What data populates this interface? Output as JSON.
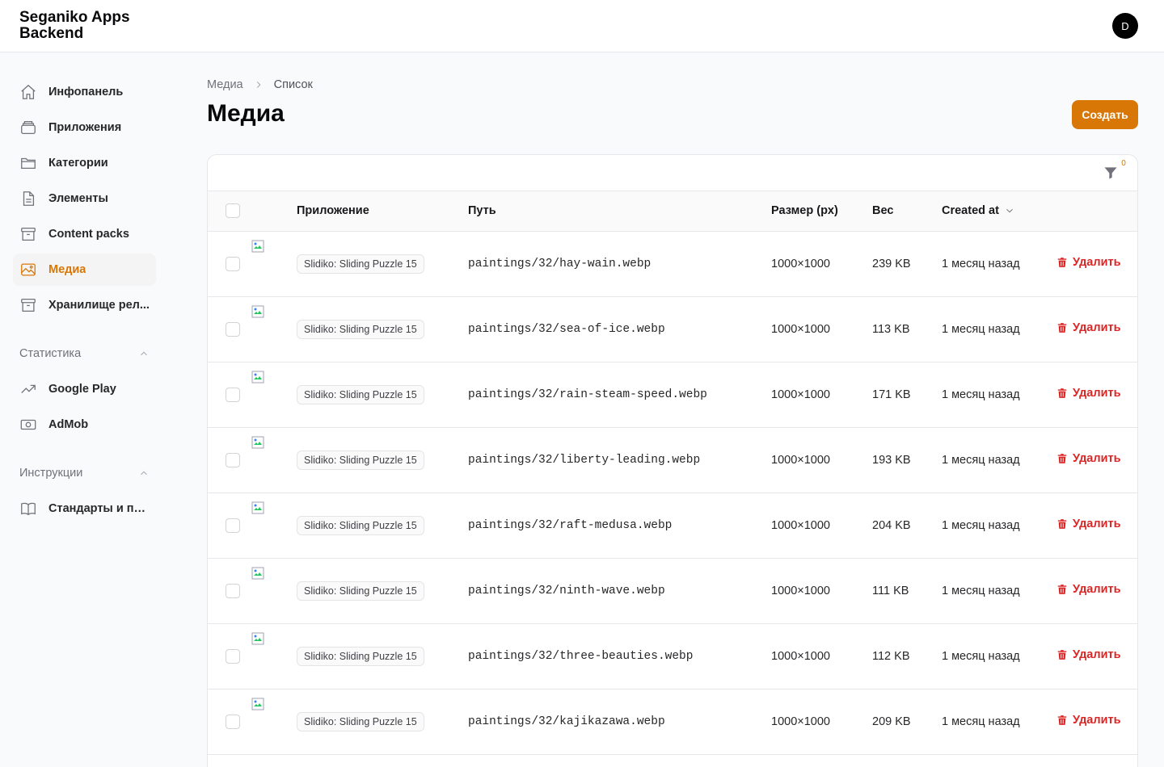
{
  "app": {
    "title": "Seganiko Apps Backend",
    "avatar_initial": "D"
  },
  "sidebar": {
    "items": [
      {
        "label": "Инфопанель",
        "icon": "home-icon",
        "active": false
      },
      {
        "label": "Приложения",
        "icon": "stack-icon",
        "active": false
      },
      {
        "label": "Категории",
        "icon": "folder-icon",
        "active": false
      },
      {
        "label": "Элементы",
        "icon": "document-icon",
        "active": false
      },
      {
        "label": "Content packs",
        "icon": "archive-icon",
        "active": false
      },
      {
        "label": "Медиа",
        "icon": "image-icon",
        "active": true
      },
      {
        "label": "Хранилище рел...",
        "icon": "archive-icon",
        "active": false
      }
    ],
    "groups": [
      {
        "label": "Статистика",
        "items": [
          {
            "label": "Google Play",
            "icon": "trending-icon"
          },
          {
            "label": "AdMob",
            "icon": "banknote-icon"
          }
        ]
      },
      {
        "label": "Инструкции",
        "items": [
          {
            "label": "Стандарты и пр...",
            "icon": "book-icon"
          }
        ]
      }
    ]
  },
  "breadcrumb": {
    "parent": "Медиа",
    "current": "Список"
  },
  "page": {
    "title": "Медиа",
    "create_label": "Создать"
  },
  "filter": {
    "count": "0"
  },
  "table": {
    "columns": {
      "app": "Приложение",
      "path": "Путь",
      "size": "Размер (px)",
      "weight": "Вес",
      "created": "Created at"
    },
    "delete_label": "Удалить",
    "rows": [
      {
        "app": "Slidiko: Sliding Puzzle 15",
        "path": "paintings/32/hay-wain.webp",
        "size": "1000×1000",
        "weight": "239 KB",
        "created": "1 месяц назад"
      },
      {
        "app": "Slidiko: Sliding Puzzle 15",
        "path": "paintings/32/sea-of-ice.webp",
        "size": "1000×1000",
        "weight": "113 KB",
        "created": "1 месяц назад"
      },
      {
        "app": "Slidiko: Sliding Puzzle 15",
        "path": "paintings/32/rain-steam-speed.webp",
        "size": "1000×1000",
        "weight": "171 KB",
        "created": "1 месяц назад"
      },
      {
        "app": "Slidiko: Sliding Puzzle 15",
        "path": "paintings/32/liberty-leading.webp",
        "size": "1000×1000",
        "weight": "193 KB",
        "created": "1 месяц назад"
      },
      {
        "app": "Slidiko: Sliding Puzzle 15",
        "path": "paintings/32/raft-medusa.webp",
        "size": "1000×1000",
        "weight": "204 KB",
        "created": "1 месяц назад"
      },
      {
        "app": "Slidiko: Sliding Puzzle 15",
        "path": "paintings/32/ninth-wave.webp",
        "size": "1000×1000",
        "weight": "111 KB",
        "created": "1 месяц назад"
      },
      {
        "app": "Slidiko: Sliding Puzzle 15",
        "path": "paintings/32/three-beauties.webp",
        "size": "1000×1000",
        "weight": "112 KB",
        "created": "1 месяц назад"
      },
      {
        "app": "Slidiko: Sliding Puzzle 15",
        "path": "paintings/32/kajikazawa.webp",
        "size": "1000×1000",
        "weight": "209 KB",
        "created": "1 месяц назад"
      }
    ]
  },
  "colors": {
    "accent": "#d97706",
    "danger": "#dc2626",
    "border": "#e5e7eb"
  }
}
